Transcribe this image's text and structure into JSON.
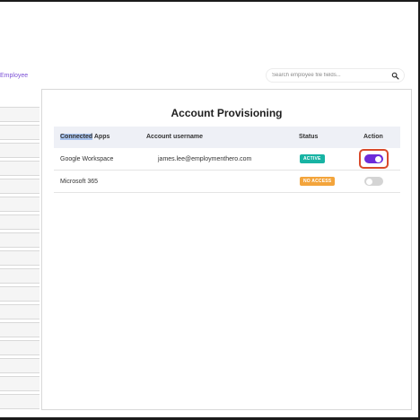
{
  "header": {
    "breadcrumb": "Employee",
    "search": {
      "placeholder": "Search employee file fields...",
      "value": ""
    }
  },
  "panel": {
    "title": "Account Provisioning",
    "columns": {
      "apps_highlight": "Connected",
      "apps_rest": " Apps",
      "username": "Account username",
      "status": "Status",
      "action": "Action"
    },
    "rows": [
      {
        "app": "Google Workspace",
        "username": "james.lee@employmenthero.com",
        "status": "ACTIVE",
        "status_color": "#17b3a3",
        "toggle_on": true,
        "toggle_color": "#6c2bd9"
      },
      {
        "app": "Microsoft 365",
        "username": "",
        "status": "NO ACCESS",
        "status_color": "#f3a43b",
        "toggle_on": false,
        "toggle_color": "#d4d4d4"
      }
    ]
  },
  "colors": {
    "accent": "#7b4fd6",
    "focus": "#d94a2b"
  },
  "icons": {
    "search": "search-icon"
  }
}
